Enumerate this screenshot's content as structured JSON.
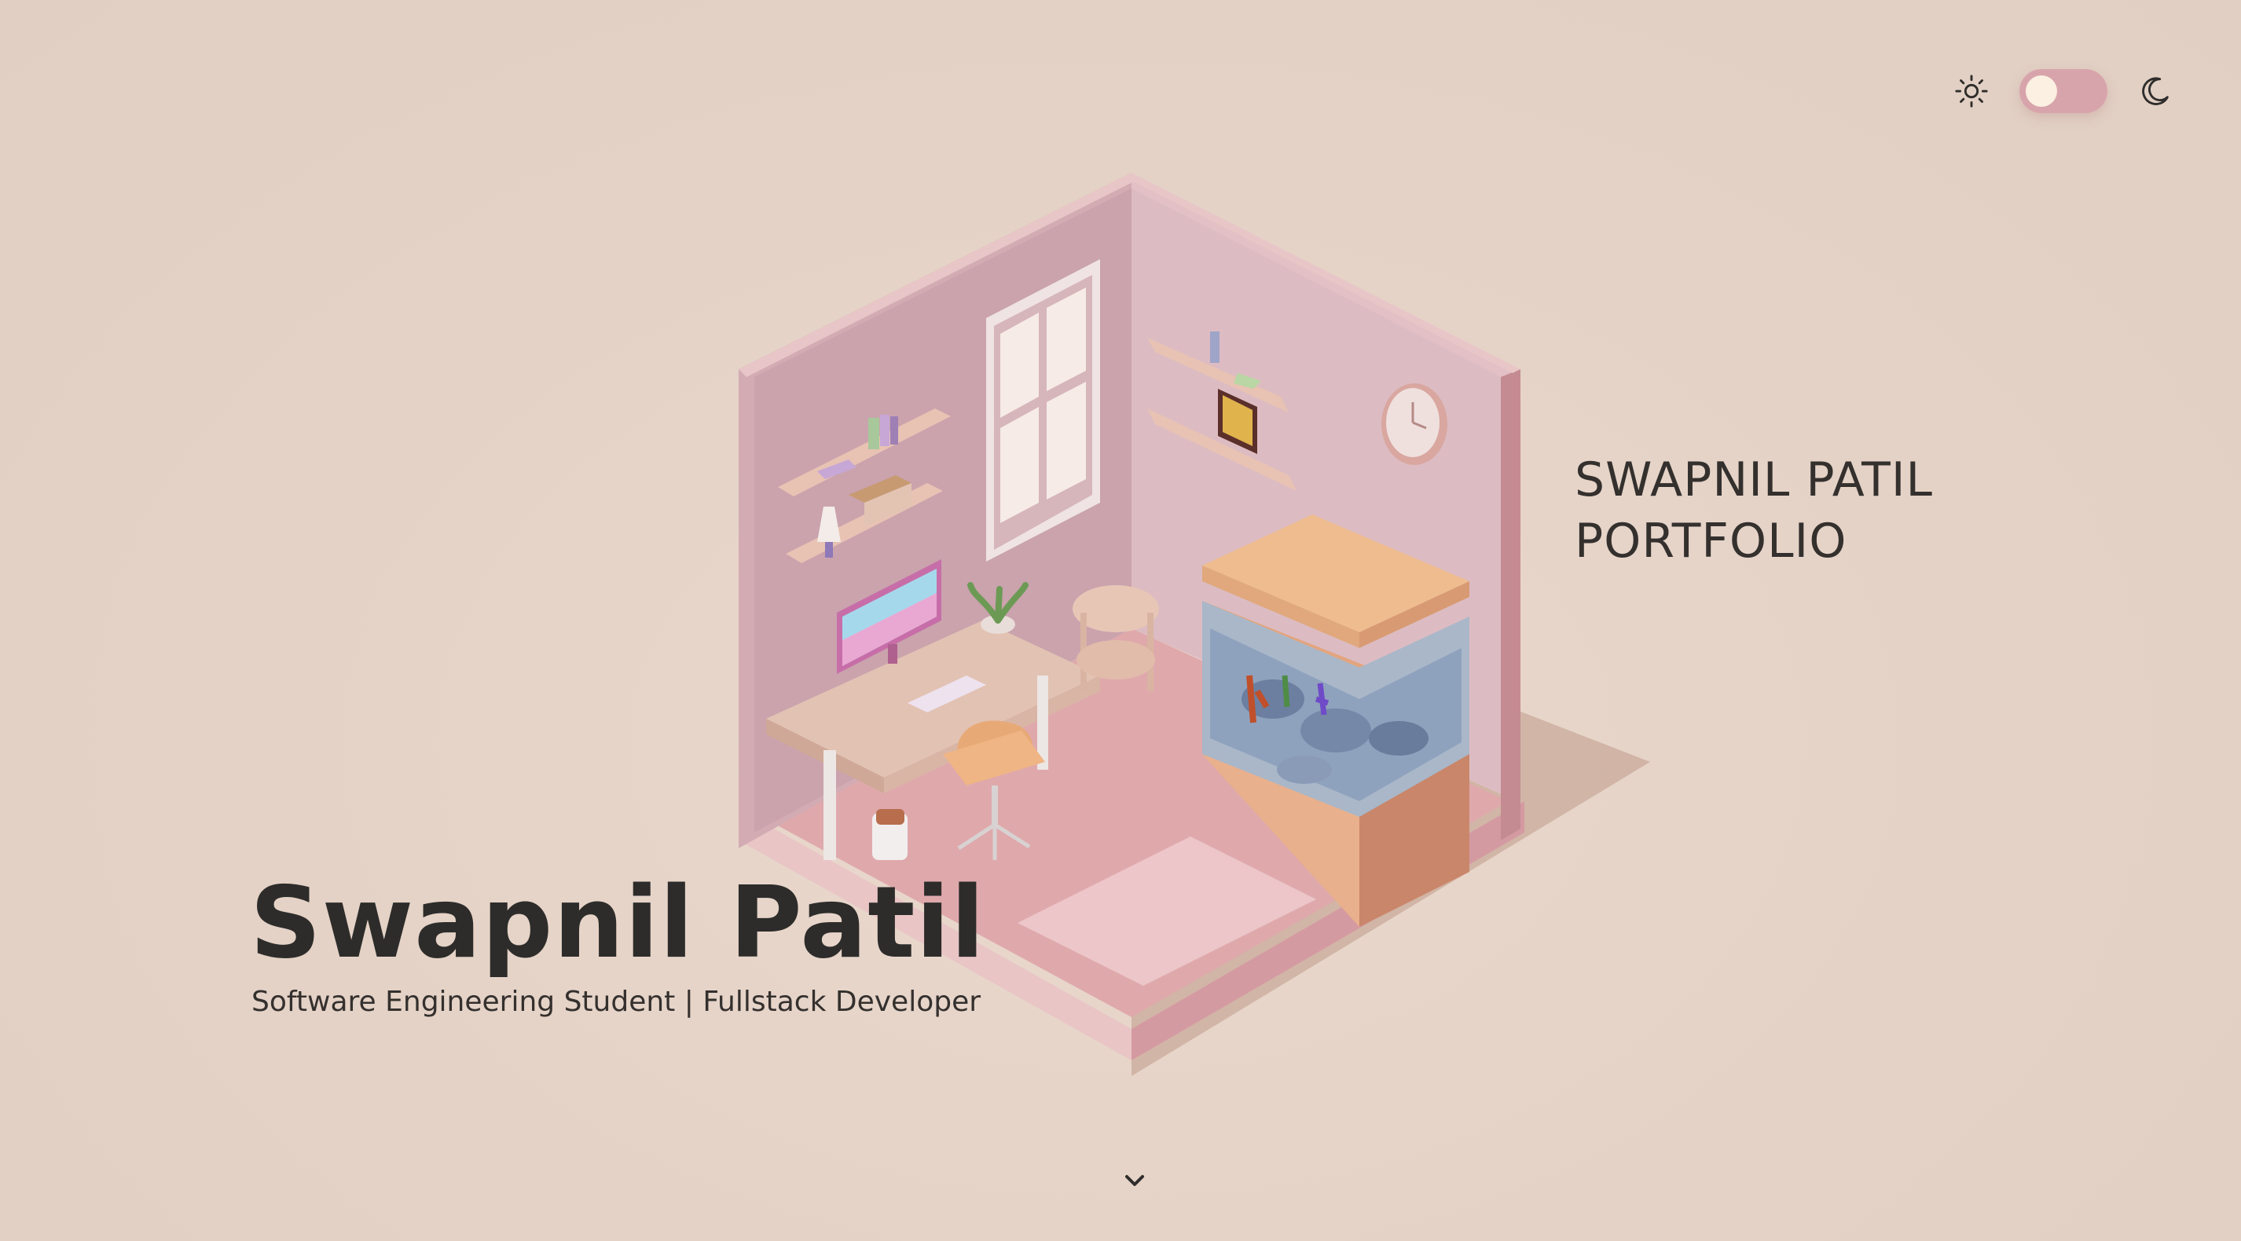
{
  "header": {
    "theme_toggle": {
      "light_icon": "sun-icon",
      "dark_icon": "moon-icon",
      "state": "light",
      "track_color": "#d8a4ab",
      "knob_color": "#fbf0e2"
    }
  },
  "hero": {
    "name": "Swapnil Patil",
    "subtitle": "Software Engineering Student | Fullstack Developer",
    "side_title_line1": "SWAPNIL PATIL",
    "side_title_line2": "PORTFOLIO"
  },
  "illustration": {
    "description_icon": "isometric-room-illustration",
    "wall_color": "#d9b3b8",
    "floor_color": "#dfa9ac"
  },
  "footer": {
    "scroll_icon": "chevron-down-icon"
  },
  "colors": {
    "background": "#e4d2c6",
    "text": "#2f2d2b",
    "accent": "#d8a4ab"
  }
}
